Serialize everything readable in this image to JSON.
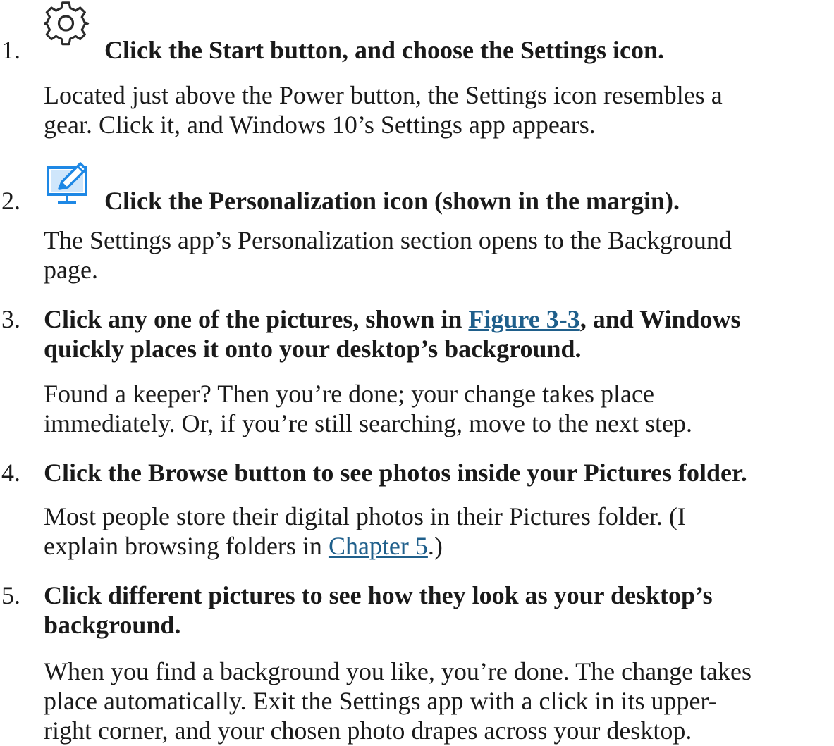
{
  "steps": [
    {
      "number": "1.",
      "icon": "gear-icon",
      "heading": "Click the Start button, and choose the Settings icon.",
      "body_lines": [
        "Located just above the Power button, the Settings icon resembles a",
        "gear. Click it, and Windows 10’s Settings app appears."
      ]
    },
    {
      "number": "2.",
      "icon": "personalization-icon",
      "heading": "Click the Personalization icon (shown in the margin).",
      "body_lines": [
        "The Settings app’s Personalization section opens to the Background",
        "page."
      ]
    },
    {
      "number": "3.",
      "heading_line1_before": "Click any one of the pictures, shown in ",
      "heading_link": "Figure 3-3",
      "heading_line1_after": ", and Windows",
      "heading_line2": "quickly places it onto your desktop’s background.",
      "body_lines": [
        "Found a keeper? Then you’re done; your change takes place",
        "immediately. Or, if you’re still searching, move to the next step."
      ]
    },
    {
      "number": "4.",
      "heading": "Click the Browse button to see photos inside your Pictures folder.",
      "body_line1": "Most people store their digital photos in their Pictures folder. (I",
      "body_line2_before": "explain browsing folders in ",
      "body_link": "Chapter 5",
      "body_line2_after": ".)"
    },
    {
      "number": "5.",
      "heading_lines": [
        "Click different pictures to see how they look as your desktop’s",
        "background."
      ],
      "body_lines": [
        "When you find a background you like, you’re done. The change takes",
        "place automatically. Exit the Settings app with a click in its upper-",
        "right corner, and your chosen photo drapes across your desktop."
      ]
    }
  ],
  "colors": {
    "text": "#1a1a1a",
    "link": "#1f5f8b",
    "icon_blue": "#1e88e5"
  }
}
